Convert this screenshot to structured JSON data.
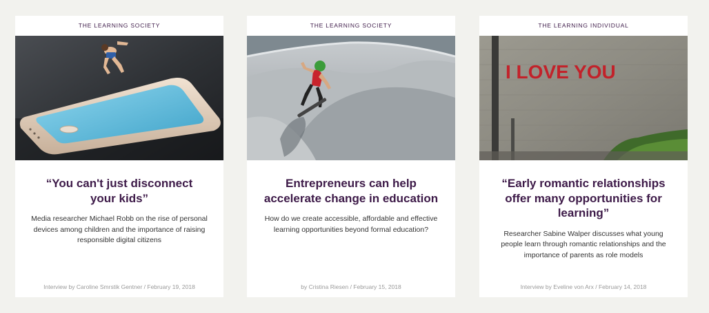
{
  "cards": [
    {
      "category": "The Learning Society",
      "title": "“You can't just disconnect your kids”",
      "excerpt": "Media researcher Michael Robb on the rise of personal devices among children and the importance of raising responsible digital citizens",
      "byline": "Interview by Caroline Smrstik Gentner / February 19, 2018",
      "image": "smartphone-diver-image"
    },
    {
      "category": "The Learning Society",
      "title": "Entrepreneurs can help accelerate change in education",
      "excerpt": "How do we create accessible, affordable and effective learning opportunities beyond formal education?",
      "byline": "by Cristina Riesen / February 15, 2018",
      "image": "skateboarder-bowl-image"
    },
    {
      "category": "The Learning Individual",
      "title": "“Early romantic relationships offer many opportunities for learning”",
      "excerpt": "Researcher Sabine Walper discusses what young people learn through romantic relationships and the importance of parents as role models",
      "byline": "Interview by Eveline von Arx / February 14, 2018",
      "image": "i-love-you-graffiti-image",
      "image_text": "I LOVE YOU"
    }
  ],
  "colors": {
    "background": "#f2f2ee",
    "card": "#ffffff",
    "accent": "#3d1a48",
    "body_text": "#333333",
    "meta_text": "#999999"
  }
}
